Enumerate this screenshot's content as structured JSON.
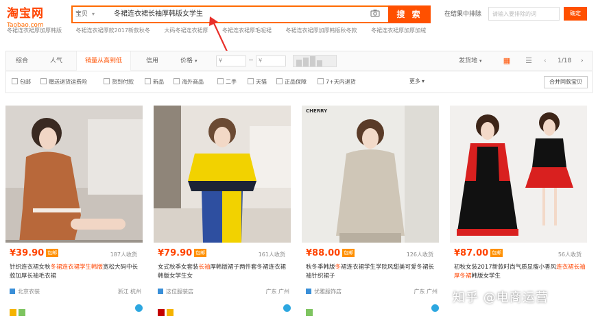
{
  "header": {
    "logo_cn": "淘宝网",
    "logo_en": "Taobao.com",
    "search_type": "宝贝",
    "search_query": "冬裙连衣裙长袖厚韩版女学生",
    "search_button": "搜 索",
    "in_results_label": "在结果中排除",
    "in_results_placeholder": "请输入要排除的词",
    "confirm_button": "确定"
  },
  "suggestions": [
    "冬裙连衣裙厚加厚韩版",
    "冬裙连衣裙厚款2017新款秋冬",
    "大码冬裙连衣裙厚",
    "冬裙连衣裙厚毛呢裙",
    "冬裙连衣裙厚加厚韩版秋冬款",
    "冬裙连衣裙厚加厚加绒"
  ],
  "sortbar": {
    "items": [
      "综合",
      "人气",
      "销量从高到低",
      "信用",
      "价格"
    ],
    "price_from": "¥",
    "price_to": "¥",
    "ship_from": "发货地",
    "page": "1/18"
  },
  "filters": [
    "包邮",
    "赠送退货运费险",
    "货到付款",
    "新品",
    "海外商品",
    "二手",
    "天猫",
    "正品保障",
    "7+天内退货"
  ],
  "filter_more": "更多",
  "merge_button": "合并同款宝贝",
  "products": [
    {
      "price": "¥39.90",
      "badge": "包邮",
      "sales": "187人收货",
      "title_pre": "针织连衣裙女秋",
      "title_hl": "冬裙连衣裙学生韩版",
      "title_post": "宽松大码中长款加厚长袖毛衣裙",
      "shop": "北京衣装",
      "loc": "浙江 杭州"
    },
    {
      "price": "¥79.90",
      "badge": "包邮",
      "sales": "161人收货",
      "title_pre": "女式秋季女套装",
      "title_hl": "长袖",
      "title_post": "厚韩版裙子两件套冬裙连衣裙韩版女学生女",
      "shop": "这位服装店",
      "loc": "广东 广州"
    },
    {
      "price": "¥88.00",
      "badge": "包邮",
      "sales": "126人收货",
      "title_pre": "秋冬季韩版",
      "title_hl": "冬",
      "title_post": "裙连衣裙学生学院风甜美可爱冬裙长袖针织裙子",
      "shop": "优雅服饰店",
      "loc": "广东 广州"
    },
    {
      "price": "¥87.00",
      "badge": "包邮",
      "sales": "56人收货",
      "title_pre": "初秋女装2017新款时尚气质显瘦小香风",
      "title_hl": "连衣裙长袖厚冬裙",
      "title_post": "韩版女学生",
      "shop": "",
      "loc": ""
    }
  ],
  "watermark": "知乎 @电商运营",
  "colors": {
    "accent": "#ff5000",
    "price": "#ff4400"
  }
}
